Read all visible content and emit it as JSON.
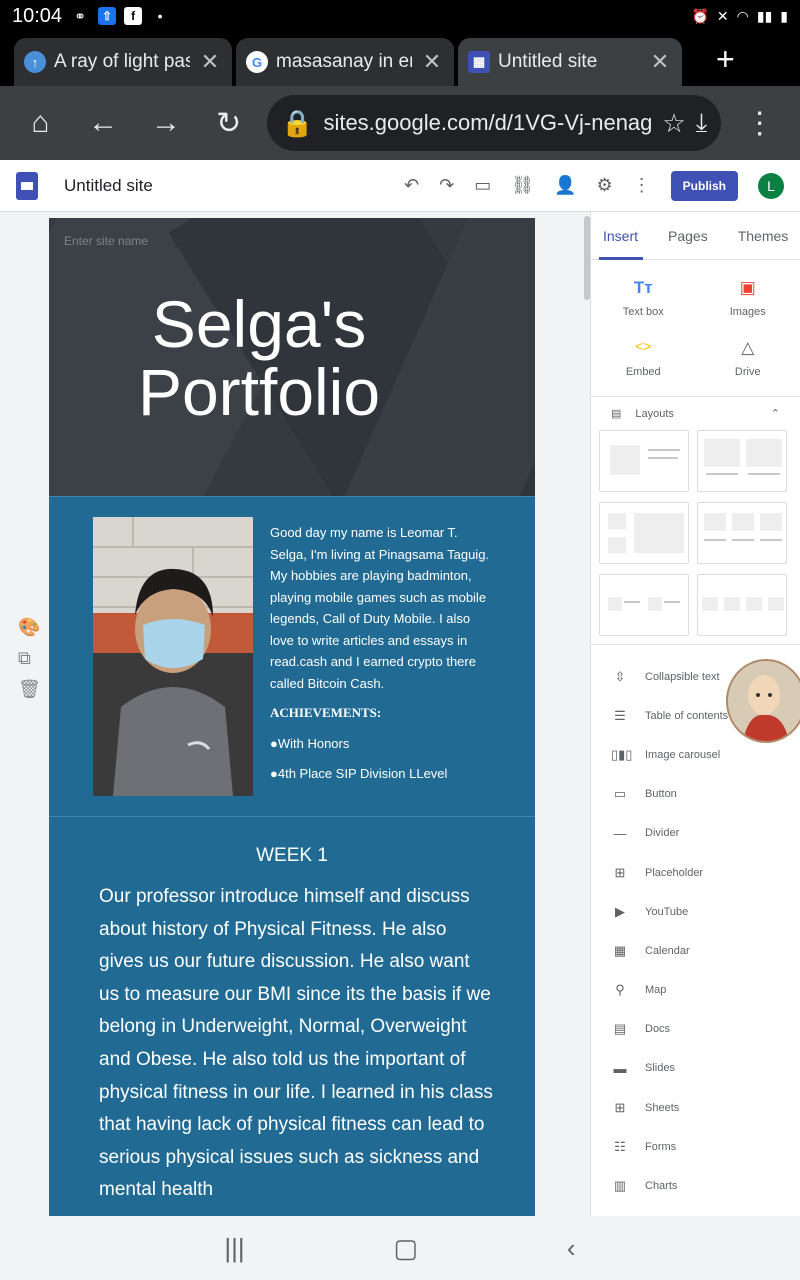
{
  "status_bar": {
    "time": "10:04"
  },
  "tabs": [
    {
      "title": "A ray of light pass",
      "icon": "upload-arrow-icon"
    },
    {
      "title": "masasanay in en",
      "icon": "google-icon"
    },
    {
      "title": "Untitled site",
      "icon": "sites-icon"
    }
  ],
  "url": "sites.google.com/d/1VG-Vj-nenag",
  "sites_toolbar": {
    "site_title": "Untitled site",
    "publish_label": "Publish",
    "avatar_letter": "L"
  },
  "header": {
    "hint": "Enter site name",
    "title_line1": "Selga's",
    "title_line2": "Portfolio"
  },
  "intro": {
    "bio": "Good day my name is Leomar T. Selga, I'm living at Pinagsama Taguig. My hobbies are playing badminton, playing mobile games such as mobile legends, Call of Duty Mobile. I also love to write articles and essays in read.cash and I earned crypto there called Bitcoin Cash.",
    "achievements_heading": "ACHIEVEMENTS:",
    "achievements": [
      "●With Honors",
      "●4th Place SIP Division LLevel"
    ]
  },
  "week": {
    "heading": "WEEK 1",
    "body": "Our professor introduce himself and discuss about history of Physical Fitness. He also gives us our future discussion. He also want us to measure our BMI since its the basis if we belong in Underweight, Normal, Overweight and Obese. He also told us the important of physical fitness in our life. I learned in his class that having lack of physical fitness can lead to serious physical issues such as sickness and mental health"
  },
  "panel": {
    "tabs": [
      "Insert",
      "Pages",
      "Themes"
    ],
    "quick": [
      {
        "label": "Text box",
        "icon": "text-box-icon"
      },
      {
        "label": "Images",
        "icon": "image-icon"
      },
      {
        "label": "Embed",
        "icon": "embed-icon"
      },
      {
        "label": "Drive",
        "icon": "drive-icon"
      }
    ],
    "layouts_label": "Layouts",
    "items": [
      "Collapsible text",
      "Table of contents",
      "Image carousel",
      "Button",
      "Divider",
      "Placeholder",
      "YouTube",
      "Calendar",
      "Map",
      "Docs",
      "Slides",
      "Sheets",
      "Forms",
      "Charts"
    ]
  },
  "colors": {
    "section_blue": "#206a94",
    "header_dark": "#343a40",
    "accent": "#3f51b5"
  }
}
